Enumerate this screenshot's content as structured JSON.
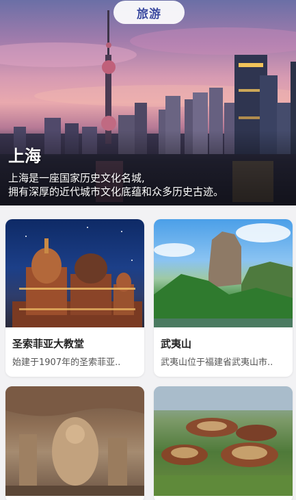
{
  "tab": {
    "label": "旅游"
  },
  "hero": {
    "city": "上海",
    "description_line1": "上海是一座国家历史文化名城,",
    "description_line2": "拥有深厚的近代城市文化底蕴和众多历史古迹。"
  },
  "cards": [
    {
      "title": "圣索菲亚大教堂",
      "description": "始建于1907年的圣索菲亚..",
      "image": "cathedral-photo"
    },
    {
      "title": "武夷山",
      "description": "武夷山位于福建省武夷山市..",
      "image": "mountain-photo"
    },
    {
      "title": "",
      "description": "",
      "image": "grotto-photo"
    },
    {
      "title": "",
      "description": "",
      "image": "tulou-photo"
    }
  ]
}
